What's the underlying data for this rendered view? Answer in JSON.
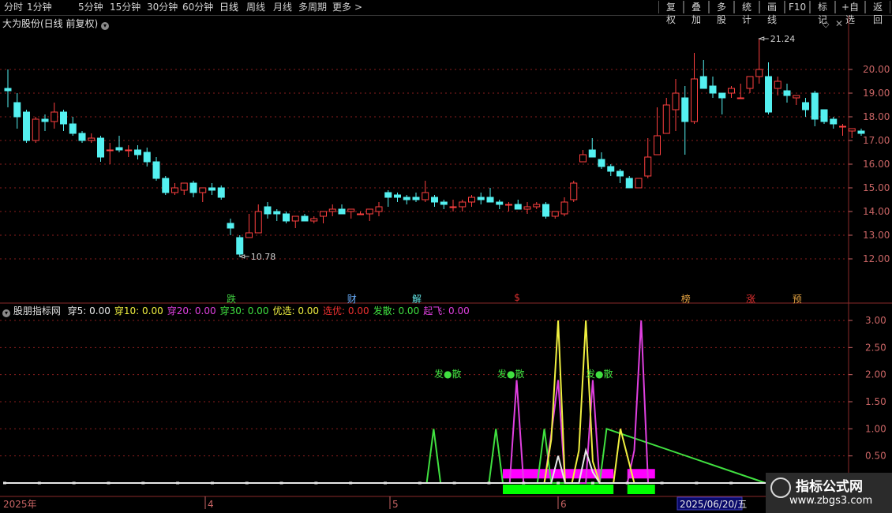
{
  "toolbar": {
    "periods": [
      {
        "label": "分时",
        "x": 5,
        "active": false
      },
      {
        "label": "1分钟",
        "x": 34,
        "active": false
      },
      {
        "label": "5分钟",
        "x": 99,
        "active": false
      },
      {
        "label": "15分钟",
        "x": 139,
        "active": false
      },
      {
        "label": "30分钟",
        "x": 186,
        "active": false
      },
      {
        "label": "60分钟",
        "x": 231,
        "active": false
      },
      {
        "label": "日线",
        "x": 278,
        "active": true
      },
      {
        "label": "周线",
        "x": 312,
        "active": false
      },
      {
        "label": "月线",
        "x": 346,
        "active": false
      },
      {
        "label": "多周期",
        "x": 378,
        "active": false
      },
      {
        "label": "更多",
        "x": 421,
        "active": false
      }
    ],
    "more_chevron": ">",
    "right_buttons": [
      "复权",
      "叠加",
      "多股",
      "统计",
      "画线",
      "F10",
      "标记",
      "+自选",
      "返回"
    ]
  },
  "price_panel": {
    "title": "大为股份(日线 前复权)",
    "title_dropdown": "▾",
    "y_ticks": [
      "20.00",
      "19.00",
      "18.00",
      "17.00",
      "16.00",
      "15.00",
      "14.00",
      "13.00",
      "12.00"
    ],
    "high_label": "21.24",
    "low_label": "10.78",
    "events": [
      {
        "label": "跌",
        "color": "#40d040"
      },
      {
        "label": "财",
        "color": "#6ab0ff"
      },
      {
        "label": "解",
        "color": "#60e0e0"
      },
      {
        "label": "$",
        "color": "#e03030"
      },
      {
        "label": "榜",
        "color": "#e0a040"
      },
      {
        "label": "涨",
        "color": "#e03030"
      },
      {
        "label": "预",
        "color": "#e0a040"
      }
    ]
  },
  "indicator_panel": {
    "title": "股朋指标网",
    "values": [
      {
        "label": "穿5: 0.00",
        "color": "#e8e8e8"
      },
      {
        "label": "穿10: 0.00",
        "color": "#f0f040"
      },
      {
        "label": "穿20: 0.00",
        "color": "#e040e0"
      },
      {
        "label": "穿30: 0.00",
        "color": "#40e040"
      },
      {
        "label": "优选: 0.00",
        "color": "#f0f040"
      },
      {
        "label": "选优: 0.00",
        "color": "#f03030"
      },
      {
        "label": "发散: 0.00",
        "color": "#40e040"
      },
      {
        "label": "起飞: 0.00",
        "color": "#e040e0"
      }
    ],
    "y_ticks": [
      "3.00",
      "2.50",
      "2.00",
      "1.50",
      "1.00",
      "0.50"
    ],
    "signal_label": "发●散"
  },
  "time_axis": {
    "labels": [
      "2025年",
      "4",
      "5",
      "6"
    ],
    "cursor_date": "2025/06/20/五"
  },
  "watermark": {
    "line1": "指标公式网",
    "line2": "www.zbgs3.com"
  },
  "colors": {
    "up": "#ff4040",
    "down": "#54f0f0",
    "grid": "#8a1e1e",
    "axis": "#c86464"
  },
  "chart_data": [
    {
      "type": "candlestick",
      "title": "大为股份(日线 前复权)",
      "ylim": [
        10.6,
        21.6
      ],
      "x": [
        "2025-03-03",
        "2025-03-04",
        "2025-03-05",
        "2025-03-06",
        "2025-03-07",
        "2025-03-10",
        "2025-03-11",
        "2025-03-12",
        "2025-03-13",
        "2025-03-14",
        "2025-03-17",
        "2025-03-18",
        "2025-03-19",
        "2025-03-20",
        "2025-03-21",
        "2025-03-24",
        "2025-03-25",
        "2025-03-26",
        "2025-03-27",
        "2025-03-28",
        "2025-03-31",
        "2025-04-01",
        "2025-04-02",
        "2025-04-03",
        "2025-04-07",
        "2025-04-08",
        "2025-04-09",
        "2025-04-10",
        "2025-04-11",
        "2025-04-14",
        "2025-04-15",
        "2025-04-16",
        "2025-04-17",
        "2025-04-18",
        "2025-04-21",
        "2025-04-22",
        "2025-04-23",
        "2025-04-24",
        "2025-04-25",
        "2025-04-28",
        "2025-04-29",
        "2025-04-30",
        "2025-05-06",
        "2025-05-07",
        "2025-05-08",
        "2025-05-09",
        "2025-05-12",
        "2025-05-13",
        "2025-05-14",
        "2025-05-15",
        "2025-05-16",
        "2025-05-19",
        "2025-05-20",
        "2025-05-21",
        "2025-05-22",
        "2025-05-23",
        "2025-05-26",
        "2025-05-27",
        "2025-05-28",
        "2025-05-29",
        "2025-05-30",
        "2025-06-03",
        "2025-06-04",
        "2025-06-05",
        "2025-06-06",
        "2025-06-09",
        "2025-06-10",
        "2025-06-11",
        "2025-06-12",
        "2025-06-13",
        "2025-06-16",
        "2025-06-17",
        "2025-06-18",
        "2025-06-19",
        "2025-06-20",
        "2025-06-23",
        "2025-06-24",
        "2025-06-25",
        "2025-06-26",
        "2025-06-27",
        "2025-06-30",
        "2025-07-01",
        "2025-07-02",
        "2025-07-03",
        "2025-07-04",
        "2025-07-07",
        "2025-07-08",
        "2025-07-09",
        "2025-07-10",
        "2025-07-11",
        "2025-07-14",
        "2025-07-15",
        "2025-07-16"
      ],
      "open": [
        19.2,
        18.6,
        18.2,
        17.0,
        17.9,
        17.8,
        18.2,
        17.7,
        17.3,
        17.0,
        17.1,
        16.6,
        16.7,
        16.6,
        16.6,
        16.5,
        16.1,
        15.4,
        14.8,
        14.9,
        15.2,
        14.8,
        15.0,
        15.0,
        13.5,
        12.9,
        12.9,
        13.1,
        14.2,
        14.0,
        13.9,
        13.6,
        13.8,
        13.6,
        13.8,
        14.0,
        14.1,
        14.0,
        13.9,
        13.9,
        14.0,
        14.8,
        14.7,
        14.6,
        14.6,
        14.5,
        14.6,
        14.4,
        14.2,
        14.2,
        14.4,
        14.6,
        14.6,
        14.4,
        14.3,
        14.3,
        14.1,
        14.2,
        14.3,
        13.8,
        13.9,
        14.5,
        16.1,
        16.6,
        16.2,
        15.9,
        15.7,
        15.4,
        15.0,
        15.5,
        16.4,
        17.3,
        18.3,
        18.8,
        17.8,
        19.7,
        19.3,
        19.0,
        19.0,
        18.8,
        19.2,
        19.7,
        19.7,
        19.2,
        19.1,
        18.8,
        18.6,
        19.0,
        18.3,
        17.9,
        17.6,
        17.4,
        17.4
      ],
      "high": [
        20.0,
        19.0,
        18.3,
        18.0,
        18.1,
        18.6,
        18.3,
        18.0,
        17.4,
        17.3,
        17.2,
        16.9,
        17.2,
        16.8,
        16.8,
        16.7,
        16.3,
        15.5,
        15.2,
        15.1,
        15.3,
        15.0,
        15.2,
        15.1,
        13.7,
        13.0,
        13.9,
        14.3,
        14.4,
        14.1,
        14.0,
        13.8,
        13.9,
        13.8,
        13.9,
        14.3,
        14.3,
        14.1,
        14.0,
        14.0,
        14.4,
        14.9,
        14.8,
        14.7,
        14.8,
        15.3,
        14.7,
        14.5,
        14.5,
        14.5,
        14.7,
        14.8,
        15.0,
        14.5,
        14.4,
        14.5,
        14.4,
        14.4,
        14.4,
        13.9,
        14.6,
        15.3,
        16.6,
        17.1,
        16.5,
        16.0,
        15.8,
        15.5,
        15.4,
        17.1,
        18.4,
        18.8,
        19.6,
        19.3,
        20.7,
        20.4,
        19.7,
        19.0,
        19.3,
        19.4,
        19.6,
        21.3,
        20.3,
        19.7,
        19.4,
        18.9,
        18.8,
        19.1,
        18.3,
        18.0,
        17.7,
        17.5,
        17.5
      ],
      "low": [
        18.4,
        17.5,
        16.9,
        16.9,
        17.4,
        17.5,
        17.4,
        17.2,
        16.9,
        16.9,
        16.1,
        16.0,
        16.5,
        16.3,
        16.2,
        15.9,
        15.3,
        14.7,
        14.7,
        14.7,
        14.6,
        14.4,
        14.7,
        14.5,
        13.0,
        12.1,
        12.9,
        13.1,
        13.7,
        13.6,
        13.5,
        13.3,
        13.6,
        13.5,
        13.5,
        13.8,
        13.9,
        13.7,
        13.9,
        13.6,
        13.8,
        14.2,
        14.4,
        14.3,
        14.4,
        14.4,
        14.2,
        14.1,
        14.0,
        14.0,
        14.2,
        14.3,
        14.4,
        14.1,
        14.0,
        14.1,
        13.9,
        14.1,
        13.7,
        13.7,
        13.8,
        14.4,
        16.1,
        16.4,
        15.8,
        15.5,
        15.2,
        15.0,
        15.0,
        15.4,
        16.4,
        17.3,
        17.4,
        16.4,
        17.7,
        19.2,
        18.8,
        18.1,
        18.8,
        18.8,
        19.0,
        19.4,
        18.1,
        18.9,
        18.6,
        18.5,
        18.0,
        17.6,
        17.7,
        17.5,
        17.2,
        17.1,
        17.2
      ],
      "close": [
        19.1,
        18.0,
        17.0,
        17.9,
        17.8,
        18.2,
        17.7,
        17.3,
        17.0,
        17.1,
        16.3,
        16.6,
        16.6,
        16.6,
        16.4,
        16.1,
        15.4,
        14.8,
        15.0,
        15.2,
        14.8,
        15.0,
        14.9,
        14.6,
        13.3,
        12.2,
        13.1,
        14.0,
        13.9,
        13.9,
        13.6,
        13.8,
        13.6,
        13.7,
        14.0,
        14.1,
        13.9,
        14.1,
        13.9,
        14.1,
        14.2,
        14.6,
        14.6,
        14.5,
        14.5,
        14.8,
        14.4,
        14.3,
        14.2,
        14.4,
        14.6,
        14.5,
        14.4,
        14.3,
        14.3,
        14.1,
        14.2,
        14.3,
        13.8,
        14.0,
        14.4,
        15.2,
        16.4,
        16.3,
        15.9,
        15.7,
        15.5,
        15.0,
        15.4,
        16.3,
        17.2,
        18.5,
        19.0,
        17.8,
        19.6,
        19.2,
        19.0,
        18.8,
        19.2,
        18.8,
        19.7,
        20.0,
        18.2,
        19.5,
        18.9,
        18.9,
        18.3,
        17.9,
        17.8,
        17.7,
        17.6,
        17.5,
        17.3
      ]
    },
    {
      "type": "line",
      "title": "股朋指标网",
      "ylim": [
        0,
        3.2
      ],
      "xlim": [
        0,
        110
      ],
      "series": [
        {
          "name": "穿5",
          "color": "#e8e8e8",
          "x": [
            0,
            76,
            77,
            78,
            79,
            80,
            81,
            82,
            83,
            84,
            85,
            86,
            87,
            88,
            89,
            90,
            91,
            92,
            110
          ],
          "y": [
            0,
            0,
            0,
            0,
            0,
            0.5,
            0,
            0,
            0,
            0.6,
            0.2,
            0,
            0,
            0,
            0,
            0,
            0,
            0,
            0
          ]
        },
        {
          "name": "穿10",
          "color": "#f0f040",
          "x": [
            0,
            73,
            74,
            75,
            76,
            77,
            78,
            79,
            80,
            81,
            82,
            83,
            84,
            85,
            86,
            87,
            88,
            89,
            90,
            91,
            92,
            110
          ],
          "y": [
            0,
            0,
            0,
            0,
            0,
            0,
            0,
            0.8,
            3.0,
            0,
            0,
            0.6,
            3.0,
            0.4,
            0,
            0,
            0,
            1.0,
            0.5,
            0,
            0,
            0
          ]
        },
        {
          "name": "穿20",
          "color": "#e040e0",
          "x": [
            0,
            72,
            73,
            74,
            75,
            76,
            77,
            78,
            79,
            80,
            81,
            82,
            83,
            84,
            85,
            86,
            87,
            88,
            89,
            90,
            91,
            92,
            93,
            94,
            95,
            110
          ],
          "y": [
            0,
            0,
            0,
            1.9,
            0,
            0,
            0,
            0,
            0.9,
            1.9,
            0,
            0,
            0,
            0,
            1.9,
            0,
            0,
            0,
            0,
            0,
            0.6,
            3.0,
            0,
            0,
            0,
            0
          ]
        },
        {
          "name": "穿30",
          "color": "#40e040",
          "x": [
            0,
            61,
            62,
            63,
            64,
            65,
            66,
            67,
            68,
            69,
            70,
            71,
            72,
            73,
            74,
            75,
            76,
            77,
            78,
            79,
            80,
            81,
            82,
            83,
            84,
            85,
            86,
            87,
            110
          ],
          "y": [
            0,
            0,
            1.0,
            0,
            0,
            0,
            0,
            0,
            0,
            0,
            0,
            1.0,
            0,
            0,
            0,
            0,
            0,
            0,
            1.0,
            0,
            0,
            0,
            0,
            0,
            0,
            0,
            0,
            1.0,
            0
          ]
        }
      ]
    }
  ]
}
